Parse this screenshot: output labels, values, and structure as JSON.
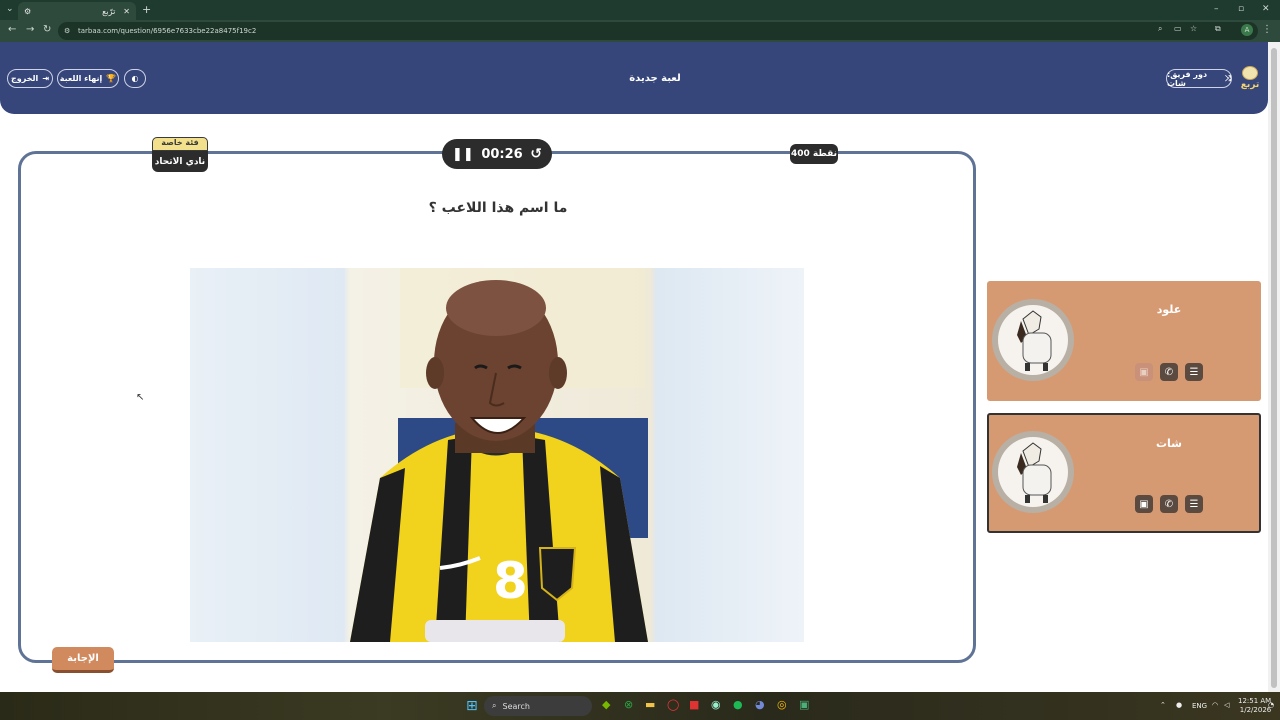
{
  "browser": {
    "tab_title": "ترّبع",
    "url": "tarbaa.com/question/6956e7633cbe22a8475f19c2",
    "new_tab": "+"
  },
  "header": {
    "exit_label": "الخروج",
    "end_game_label": "إنهاء اللعبة",
    "game_title": "لعبة جديدة",
    "turn_label": "دور فريق: شات",
    "logo_text": "تربع"
  },
  "question": {
    "timer": "00:26",
    "points": "400 نقطة",
    "category_tag": "فئة خاصة",
    "category_name": "نادي الاتحاد",
    "text": "ما اسم هذا اللاعب ؟",
    "answer_label": "الإجابة",
    "jersey_number": "8"
  },
  "teams": [
    {
      "name": "علود",
      "active": false
    },
    {
      "name": "شات",
      "active": true
    }
  ],
  "taskbar": {
    "search_label": "Search",
    "lang": "ENG",
    "time": "12:51 AM",
    "date": "1/2/2026"
  },
  "colors": {
    "header": "#36467a",
    "team_card": "#d69a73",
    "card_border": "#5f7396"
  }
}
